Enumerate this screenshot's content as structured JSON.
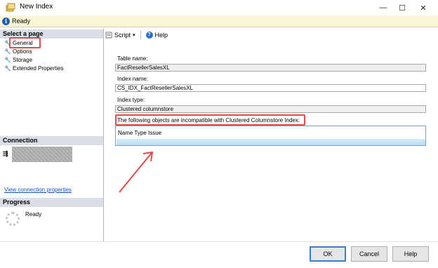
{
  "window": {
    "title": "New Index",
    "buttons": {
      "minimize": "—",
      "maximize": "☐",
      "close": "✕"
    }
  },
  "status": {
    "icon": "info-icon",
    "text": "Ready"
  },
  "left_pane": {
    "select_page_header": "Select a page",
    "pages": [
      {
        "label": "General",
        "icon": "wrench-icon",
        "selected": true
      },
      {
        "label": "Options",
        "icon": "wrench-icon"
      },
      {
        "label": "Storage",
        "icon": "wrench-icon"
      },
      {
        "label": "Extended Properties",
        "icon": "wrench-icon"
      }
    ],
    "connection_header": "Connection",
    "connection_link": "View connection properties",
    "progress_header": "Progress",
    "progress_text": "Ready"
  },
  "toolbar": {
    "script_label": "Script",
    "help_label": "Help"
  },
  "form": {
    "table_name_label": "Table name:",
    "table_name_value": "FactResellerSalesXL",
    "index_name_label": "Index name:",
    "index_name_value": "CS_IDX_FactResellerSalesXL",
    "index_type_label": "Index type:",
    "index_type_value": "Clustered columnstore",
    "incompatible_label": "The following objects are incompatible with Clustered Columnstore Index:",
    "grid_header": "Name Type Issue"
  },
  "footer": {
    "ok_label": "OK",
    "cancel_label": "Cancel",
    "help_label": "Help"
  },
  "colors": {
    "highlight": "#e34a4a",
    "link": "#1a50b5",
    "status_bg": "#fbf7d6"
  }
}
